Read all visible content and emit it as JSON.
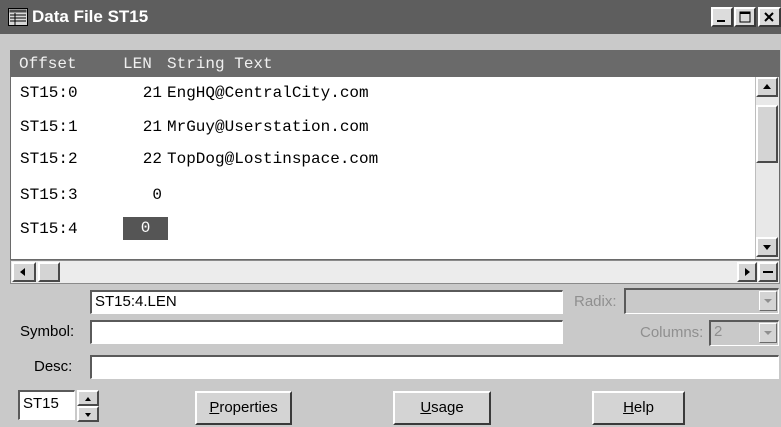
{
  "window": {
    "title": "Data File ST15"
  },
  "columns": {
    "offset": "Offset",
    "len": "LEN",
    "text": "String Text"
  },
  "rows": [
    {
      "offset": "ST15:0",
      "len": "21",
      "text": "EngHQ@CentralCity.com"
    },
    {
      "offset": "ST15:1",
      "len": "21",
      "text": "MrGuy@Userstation.com"
    },
    {
      "offset": "ST15:2",
      "len": "22",
      "text": "TopDog@Lostinspace.com"
    },
    {
      "offset": "ST15:3",
      "len": "0",
      "text": ""
    },
    {
      "offset": "ST15:4",
      "len": "0",
      "text": ""
    }
  ],
  "address_field": {
    "value": "ST15:4.LEN"
  },
  "radix": {
    "label": "Radix:",
    "value": ""
  },
  "symbol": {
    "label": "Symbol:",
    "value": ""
  },
  "columns_setting": {
    "label": "Columns:",
    "value": "2"
  },
  "desc": {
    "label": "Desc:",
    "value": ""
  },
  "file_spinner": {
    "value": "ST15"
  },
  "buttons": {
    "properties": {
      "first": "P",
      "rest": "roperties"
    },
    "usage": {
      "first": "U",
      "rest": "sage"
    },
    "help": {
      "first": "H",
      "rest": "elp"
    }
  },
  "colors": {
    "titlebar": "#5e5e5e",
    "header": "#6a6a6a",
    "selection": "#555555"
  },
  "icons": [
    "data-file-icon",
    "minimize-icon",
    "maximize-icon",
    "close-icon",
    "scroll-up-icon",
    "scroll-down-icon",
    "scroll-left-icon",
    "scroll-right-icon",
    "split-icon",
    "spin-up-icon",
    "spin-down-icon",
    "dropdown-arrow-icon"
  ]
}
